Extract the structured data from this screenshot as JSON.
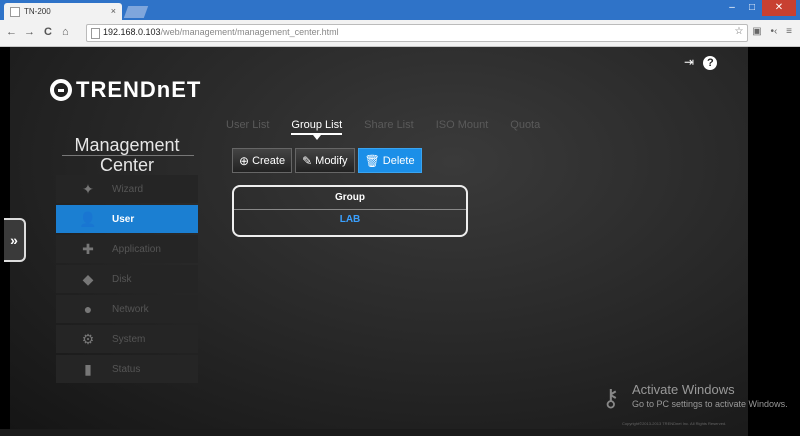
{
  "browser": {
    "tab_title": "TN-200",
    "tab_close": "×",
    "window_controls": {
      "minimize": "–",
      "maximize": "□",
      "close": "✕"
    },
    "nav": {
      "back": "←",
      "forward": "→",
      "reload": "C",
      "home": "⌂"
    },
    "url_host": "192.168.0.103",
    "url_path": "/web/management/management_center.html",
    "toolbar_icons": {
      "star": "☆",
      "ext": "▣",
      "dots": "•‹",
      "menu": "≡"
    }
  },
  "app": {
    "logo_text": "TRENDnET",
    "top_icons": {
      "logout": "⇥",
      "help": "?"
    },
    "title_line1": "Management",
    "title_line2": "Center",
    "expander": "»"
  },
  "sidebar": {
    "items": [
      {
        "label": "Wizard",
        "icon": "magic-wand-icon",
        "glyph": "✦",
        "active": false
      },
      {
        "label": "User",
        "icon": "user-icon",
        "glyph": "👤",
        "active": true
      },
      {
        "label": "Application",
        "icon": "puzzle-icon",
        "glyph": "✚",
        "active": false
      },
      {
        "label": "Disk",
        "icon": "disk-icon",
        "glyph": "◆",
        "active": false
      },
      {
        "label": "Network",
        "icon": "network-icon",
        "glyph": "●",
        "active": false
      },
      {
        "label": "System",
        "icon": "gears-icon",
        "glyph": "⚙",
        "active": false
      },
      {
        "label": "Status",
        "icon": "bars-icon",
        "glyph": "▮",
        "active": false
      }
    ]
  },
  "tabs": [
    {
      "label": "User List",
      "active": false
    },
    {
      "label": "Group List",
      "active": true
    },
    {
      "label": "Share List",
      "active": false
    },
    {
      "label": "ISO Mount",
      "active": false
    },
    {
      "label": "Quota",
      "active": false
    }
  ],
  "actions": {
    "create": "Create",
    "modify": "Modify",
    "delete": "Delete"
  },
  "group_table": {
    "header": "Group",
    "rows": [
      "LAB"
    ]
  },
  "watermark": {
    "title": "Activate Windows",
    "subtitle": "Go to PC settings to activate Windows."
  },
  "copyright": "Copyright©2013-2013 TRENDnet Inc. All Rights Reserved.",
  "colors": {
    "accent": "#1b7fd2",
    "delete_button": "#1b8fe8",
    "row_text": "#3aa0ff"
  }
}
